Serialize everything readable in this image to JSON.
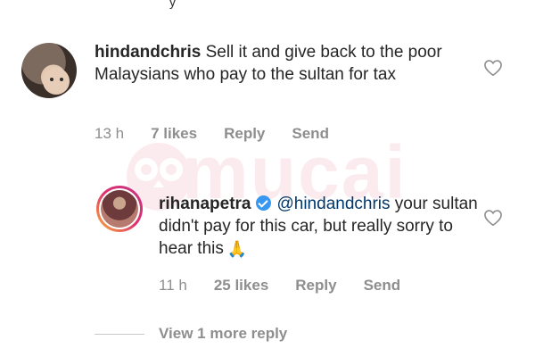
{
  "top_fragment": "y",
  "watermark": {
    "text": "mucai"
  },
  "comments": [
    {
      "username": "hindandchris",
      "text": "Sell it and give back to the poor Malaysians who pay to the sultan for tax",
      "time": "13 h",
      "likes": "7 likes",
      "reply_label": "Reply",
      "send_label": "Send"
    },
    {
      "username": "rihanapetra",
      "verified": true,
      "mention": "@hindandchris",
      "text": "your sultan didn't pay for this car, but really sorry to hear this",
      "emoji": "🙏",
      "time": "11 h",
      "likes": "25 likes",
      "reply_label": "Reply",
      "send_label": "Send"
    }
  ],
  "view_more": "View 1 more reply",
  "colors": {
    "text": "#262626",
    "meta": "#8e8e8e",
    "verified": "#3897f0",
    "mention": "#00376b",
    "watermark": "#f8d4dd"
  }
}
